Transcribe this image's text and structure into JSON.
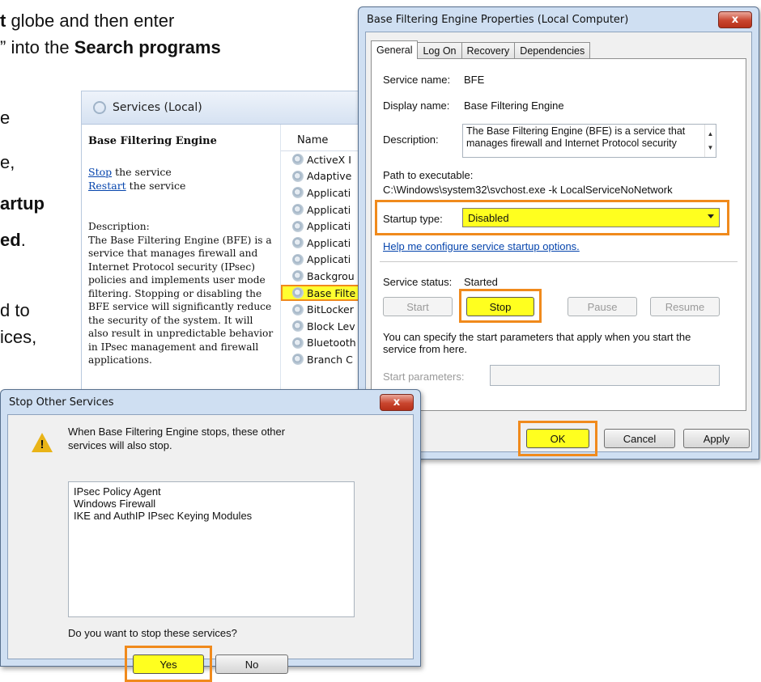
{
  "background_text": {
    "line1_bold": "t",
    "line1_rest": " globe and then enter",
    "line2_pre": "” into the ",
    "line2_bold": "Search programs",
    "line3": "e",
    "line4": "e,",
    "line5_bold": "artup",
    "line6_bold": "ed",
    "line6_rest": ".",
    "line7": "d to",
    "line8": "ices,"
  },
  "services_panel": {
    "title": "Services (Local)",
    "selected_name": "Base Filtering Engine",
    "stop_link": "Stop",
    "stop_suffix": " the service",
    "restart_link": "Restart",
    "restart_suffix": " the service",
    "description_label": "Description:",
    "description": "The Base Filtering Engine (BFE) is a service that manages firewall and Internet Protocol security (IPsec) policies and implements user mode filtering. Stopping or disabling the BFE service will significantly reduce the security of the system. It will also result in unpredictable behavior in IPsec management and firewall applications.",
    "name_column": "Name",
    "rows": [
      "ActiveX I",
      "Adaptive",
      "Applicati",
      "Applicati",
      "Applicati",
      "Applicati",
      "Applicati",
      "Backgrou",
      "Base Filte",
      "BitLocker",
      "Block Lev",
      "Bluetooth",
      "Branch C"
    ],
    "selected_row_index": 8
  },
  "properties_dialog": {
    "title": "Base Filtering Engine Properties (Local Computer)",
    "close_glyph": "x",
    "tabs": [
      "General",
      "Log On",
      "Recovery",
      "Dependencies"
    ],
    "active_tab": "General",
    "service_name_label": "Service name:",
    "service_name": "BFE",
    "display_name_label": "Display name:",
    "display_name": "Base Filtering Engine",
    "description_label": "Description:",
    "description": "The Base Filtering Engine (BFE) is a service that manages firewall and Internet Protocol security",
    "path_label": "Path to executable:",
    "path": "C:\\Windows\\system32\\svchost.exe -k LocalServiceNoNetwork",
    "startup_type_label": "Startup type:",
    "startup_type": "Disabled",
    "help_link": "Help me configure service startup options.",
    "service_status_label": "Service status:",
    "service_status": "Started",
    "start_button": "Start",
    "stop_button": "Stop",
    "pause_button": "Pause",
    "resume_button": "Resume",
    "start_params_note": "You can specify the start parameters that apply when you start the service from here.",
    "start_params_label": "Start parameters:",
    "ok_button": "OK",
    "cancel_button": "Cancel",
    "apply_button": "Apply"
  },
  "stop_dialog": {
    "title": "Stop Other Services",
    "close_glyph": "x",
    "message": "When Base Filtering Engine stops, these other services will also stop.",
    "services": [
      "IPsec Policy Agent",
      "Windows Firewall",
      "IKE and AuthIP IPsec Keying Modules"
    ],
    "question": "Do you want to stop these services?",
    "yes_button": "Yes",
    "no_button": "No"
  },
  "colors": {
    "highlight_yellow": "#ffff1f",
    "highlight_orange": "#f08a1c",
    "link_blue": "#0645ad",
    "close_red": "#c9452e"
  }
}
